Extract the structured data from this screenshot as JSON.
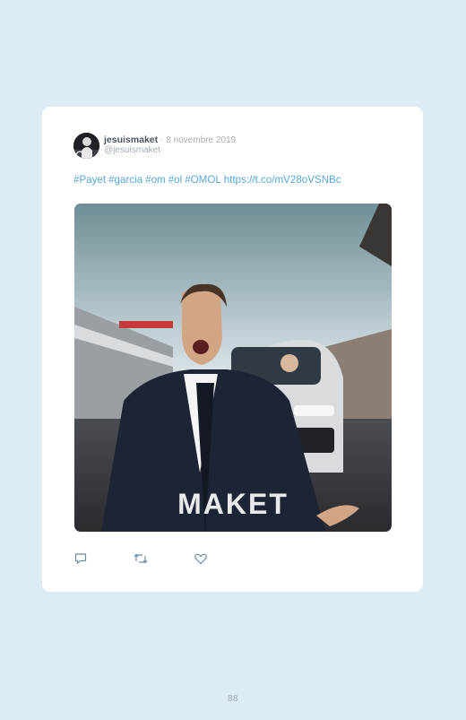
{
  "tweet": {
    "author_name": "jesuismaket",
    "separator": "·",
    "date": "8 novembre 2019",
    "handle": "@jesuismaket",
    "hashtags": [
      "#Payet",
      "#garcia",
      "#om",
      "#ol",
      "#OMOL"
    ],
    "link": "https://t.co/mV28oVSNBc",
    "media": {
      "watermark": "MAKET"
    }
  },
  "actions": [
    {
      "name": "reply-icon"
    },
    {
      "name": "retweet-icon"
    },
    {
      "name": "like-icon"
    }
  ],
  "page": {
    "number": "88"
  },
  "colors": {
    "background": "#dbecf4",
    "card": "#ffffff",
    "link": "#58a8d8",
    "icon": "#6e8fa8"
  }
}
